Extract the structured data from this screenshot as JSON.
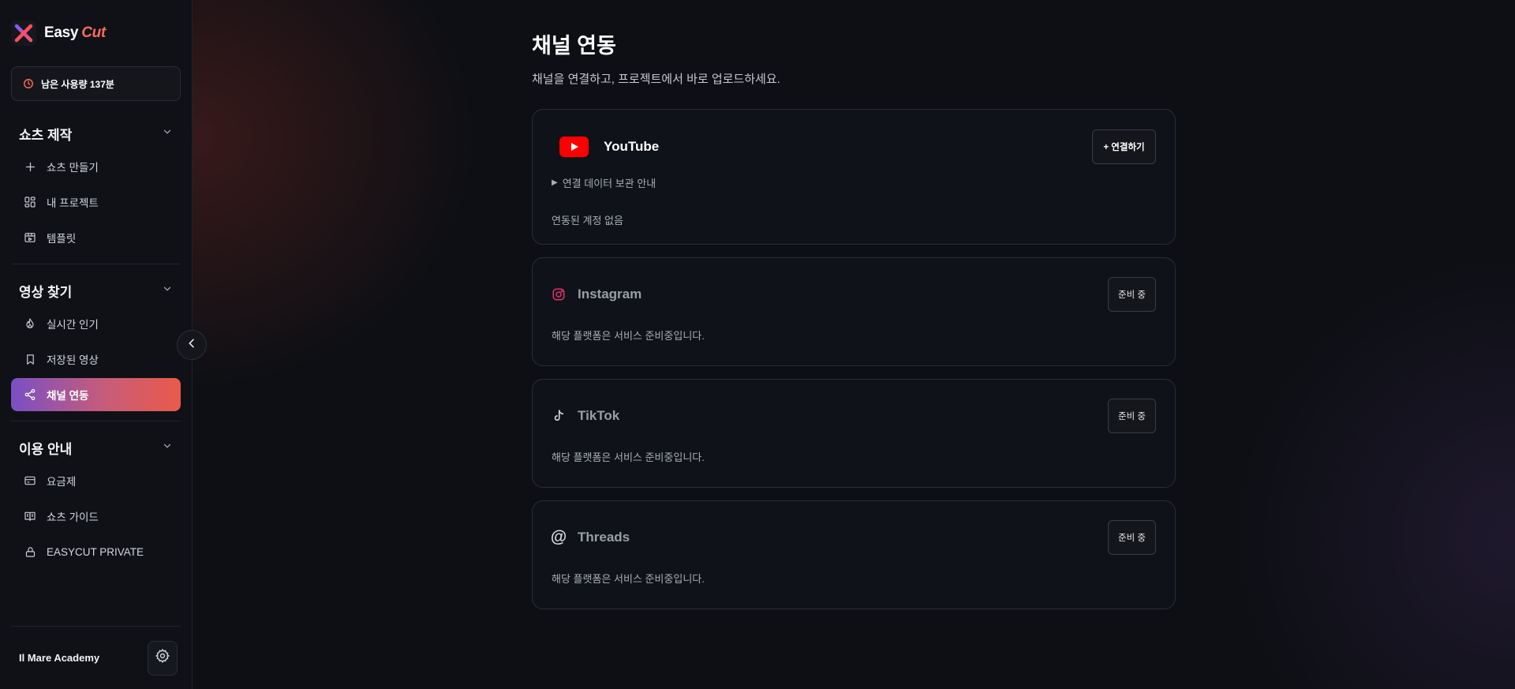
{
  "brand": {
    "name": "Easy",
    "accent": "Cut"
  },
  "usage": {
    "label": "남은 사용량 137분"
  },
  "sidebar": {
    "sections": [
      {
        "title": "쇼츠 제작",
        "items": [
          {
            "label": "쇼츠 만들기",
            "icon": "plus-icon"
          },
          {
            "label": "내 프로젝트",
            "icon": "grid-icon"
          },
          {
            "label": "템플릿",
            "icon": "template-icon"
          }
        ]
      },
      {
        "title": "영상 찾기",
        "items": [
          {
            "label": "실시간 인기",
            "icon": "flame-icon"
          },
          {
            "label": "저장된 영상",
            "icon": "bookmark-icon"
          },
          {
            "label": "채널 연동",
            "icon": "share-icon",
            "active": true
          }
        ]
      },
      {
        "title": "이용 안내",
        "items": [
          {
            "label": "요금제",
            "icon": "card-icon"
          },
          {
            "label": "쇼츠 가이드",
            "icon": "book-icon"
          },
          {
            "label": "EASYCUT PRIVATE",
            "icon": "lock-icon"
          }
        ]
      }
    ],
    "footer": {
      "user_name": "Il Mare Academy"
    }
  },
  "page": {
    "title": "채널 연동",
    "subtitle": "채널을 연결하고, 프로젝트에서 바로 업로드하세요."
  },
  "channels": {
    "youtube": {
      "name": "YouTube",
      "button": "+ 연결하기",
      "disclosure": "연결 데이터 보관 안내",
      "status": "연동된 계정 없음"
    },
    "instagram": {
      "name": "Instagram",
      "button": "준비 중",
      "status": "해당 플랫폼은 서비스 준비중입니다."
    },
    "tiktok": {
      "name": "TikTok",
      "button": "준비 중",
      "status": "해당 플랫폼은 서비스 준비중입니다."
    },
    "threads": {
      "name": "Threads",
      "button": "준비 중",
      "status": "해당 플랫폼은 서비스 준비중입니다."
    }
  },
  "colors": {
    "accent": "#ff6b5a",
    "active_gradient_start": "#7a4fc4",
    "active_gradient_end": "#ea5a4a",
    "youtube_red": "#ff0000",
    "instagram_pink": "#e1306c"
  }
}
